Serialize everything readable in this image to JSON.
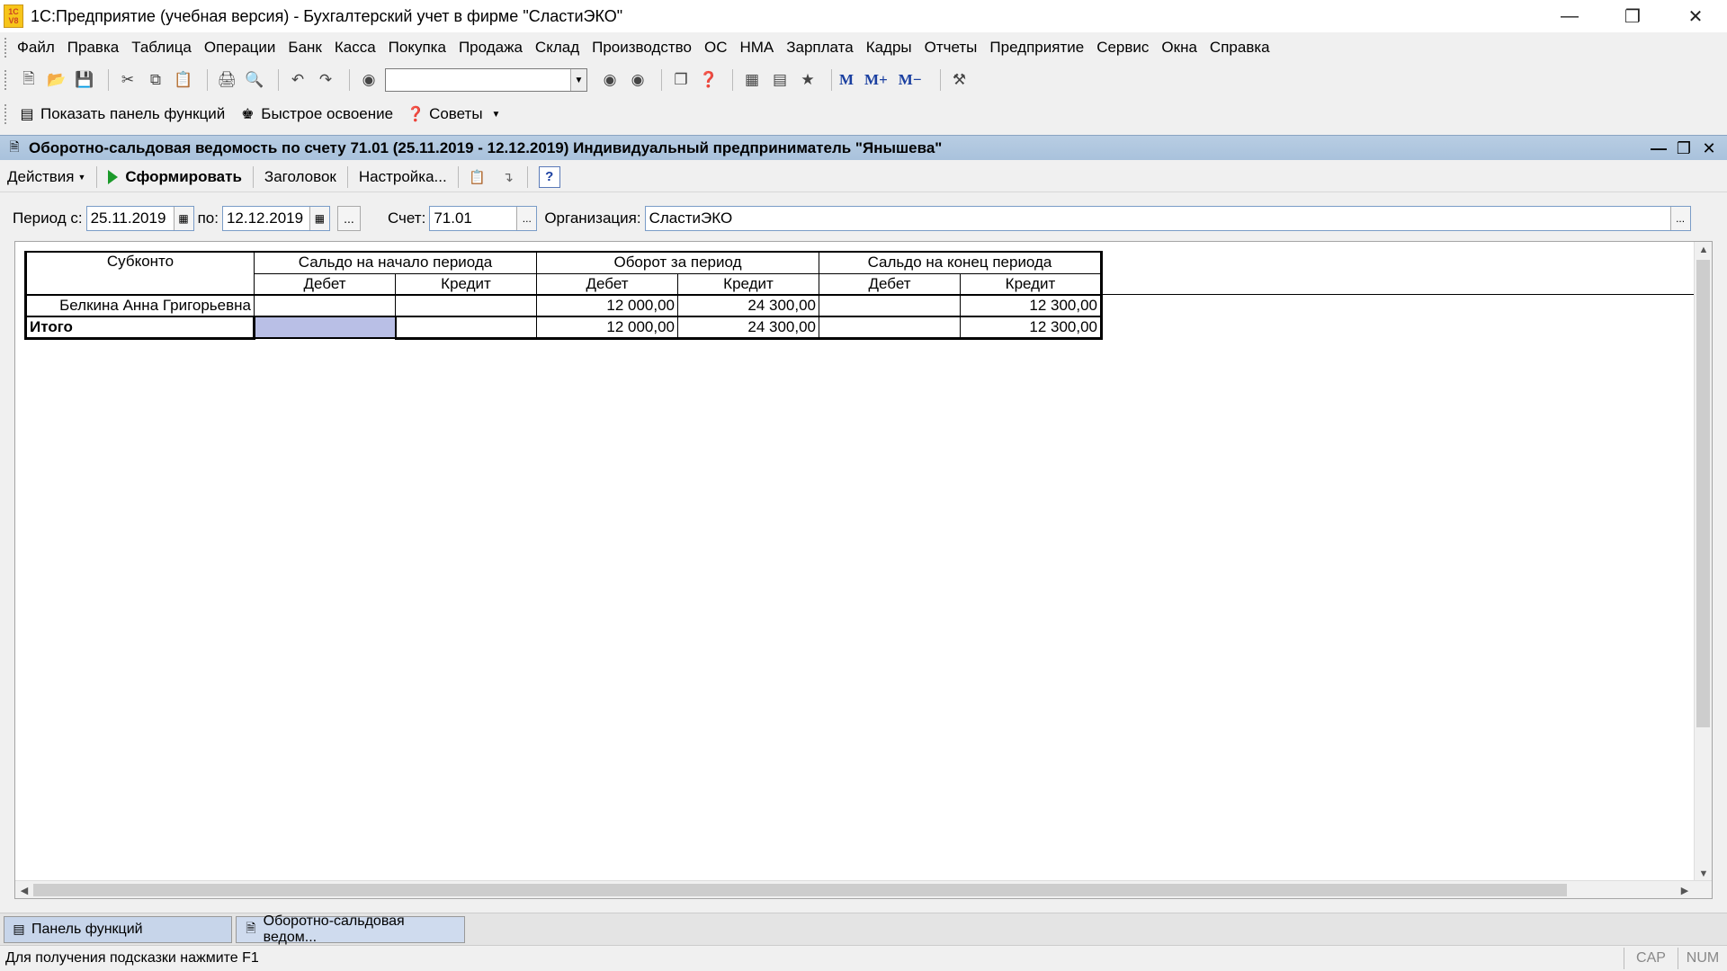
{
  "window": {
    "title": "1С:Предприятие (учебная версия) - Бухгалтерский учет в фирме \"СластиЭКО\"",
    "logo_text_top": "1C",
    "logo_text_bottom": "V8",
    "minimize_icon": "minimize-icon",
    "restore_icon": "restore-icon",
    "close_icon": "close-icon"
  },
  "menu": [
    "Файл",
    "Правка",
    "Таблица",
    "Операции",
    "Банк",
    "Касса",
    "Покупка",
    "Продажа",
    "Склад",
    "Производство",
    "ОС",
    "НМА",
    "Зарплата",
    "Кадры",
    "Отчеты",
    "Предприятие",
    "Сервис",
    "Окна",
    "Справка"
  ],
  "toolbar": {
    "search_value": "",
    "m_labels": [
      "M",
      "M+",
      "M−"
    ]
  },
  "toolbar2": {
    "show_panel": "Показать панель функций",
    "quick_learn": "Быстрое освоение",
    "tips": "Советы"
  },
  "document": {
    "title": "Оборотно-сальдовая ведомость по счету 71.01 (25.11.2019 - 12.12.2019) Индивидуальный предприниматель \"Янышева\"",
    "actions": "Действия",
    "generate": "Сформировать",
    "header_btn": "Заголовок",
    "settings": "Настройка...",
    "help": "?"
  },
  "params": {
    "period_from_label": "Период с:",
    "period_from": "25.11.2019",
    "period_to_label": "по:",
    "period_to": "12.12.2019",
    "dots": "...",
    "account_label": "Счет:",
    "account": "71.01",
    "org_label": "Организация:",
    "org": "СластиЭКО"
  },
  "report": {
    "subconto_header": "Субконто",
    "group_headers": [
      "Сальдо на начало периода",
      "Оборот за период",
      "Сальдо на конец периода"
    ],
    "sub_headers": [
      "Дебет",
      "Кредит",
      "Дебет",
      "Кредит",
      "Дебет",
      "Кредит"
    ],
    "rows": [
      {
        "name": "Белкина Анна Григорьевна",
        "values": [
          "",
          "",
          "12 000,00",
          "24 300,00",
          "",
          "12 300,00"
        ]
      }
    ],
    "total": {
      "name": "Итого",
      "values": [
        "",
        "",
        "12 000,00",
        "24 300,00",
        "",
        "12 300,00"
      ]
    }
  },
  "taskbar": {
    "functions_panel": "Панель функций",
    "doc_tab": "Оборотно-сальдовая ведом..."
  },
  "status": {
    "hint": "Для получения подсказки нажмите F1",
    "cap": "CAP",
    "num": "NUM"
  }
}
